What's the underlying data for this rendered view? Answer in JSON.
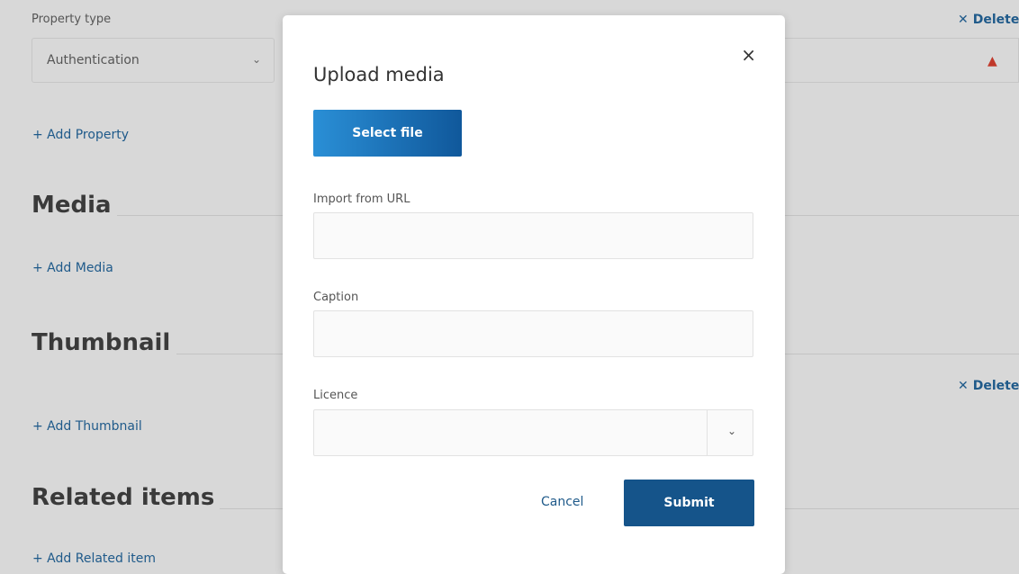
{
  "background": {
    "property_type_label": "Property type",
    "property_type_value": "Authentication",
    "delete_label": "Delete",
    "add_property": "+ Add Property",
    "media_heading": "Media",
    "add_media": "+ Add Media",
    "thumbnail_heading": "Thumbnail",
    "add_thumbnail": "+ Add Thumbnail",
    "related_heading": "Related items",
    "add_related": "+ Add Related item"
  },
  "modal": {
    "title": "Upload media",
    "close_icon": "×",
    "select_file": "Select file",
    "import_url_label": "Import from URL",
    "import_url_value": "",
    "caption_label": "Caption",
    "caption_value": "",
    "licence_label": "Licence",
    "licence_value": "",
    "cancel": "Cancel",
    "submit": "Submit"
  },
  "colors": {
    "accent": "#15548a",
    "link": "#1f5a8a",
    "warning": "#c0392b"
  }
}
